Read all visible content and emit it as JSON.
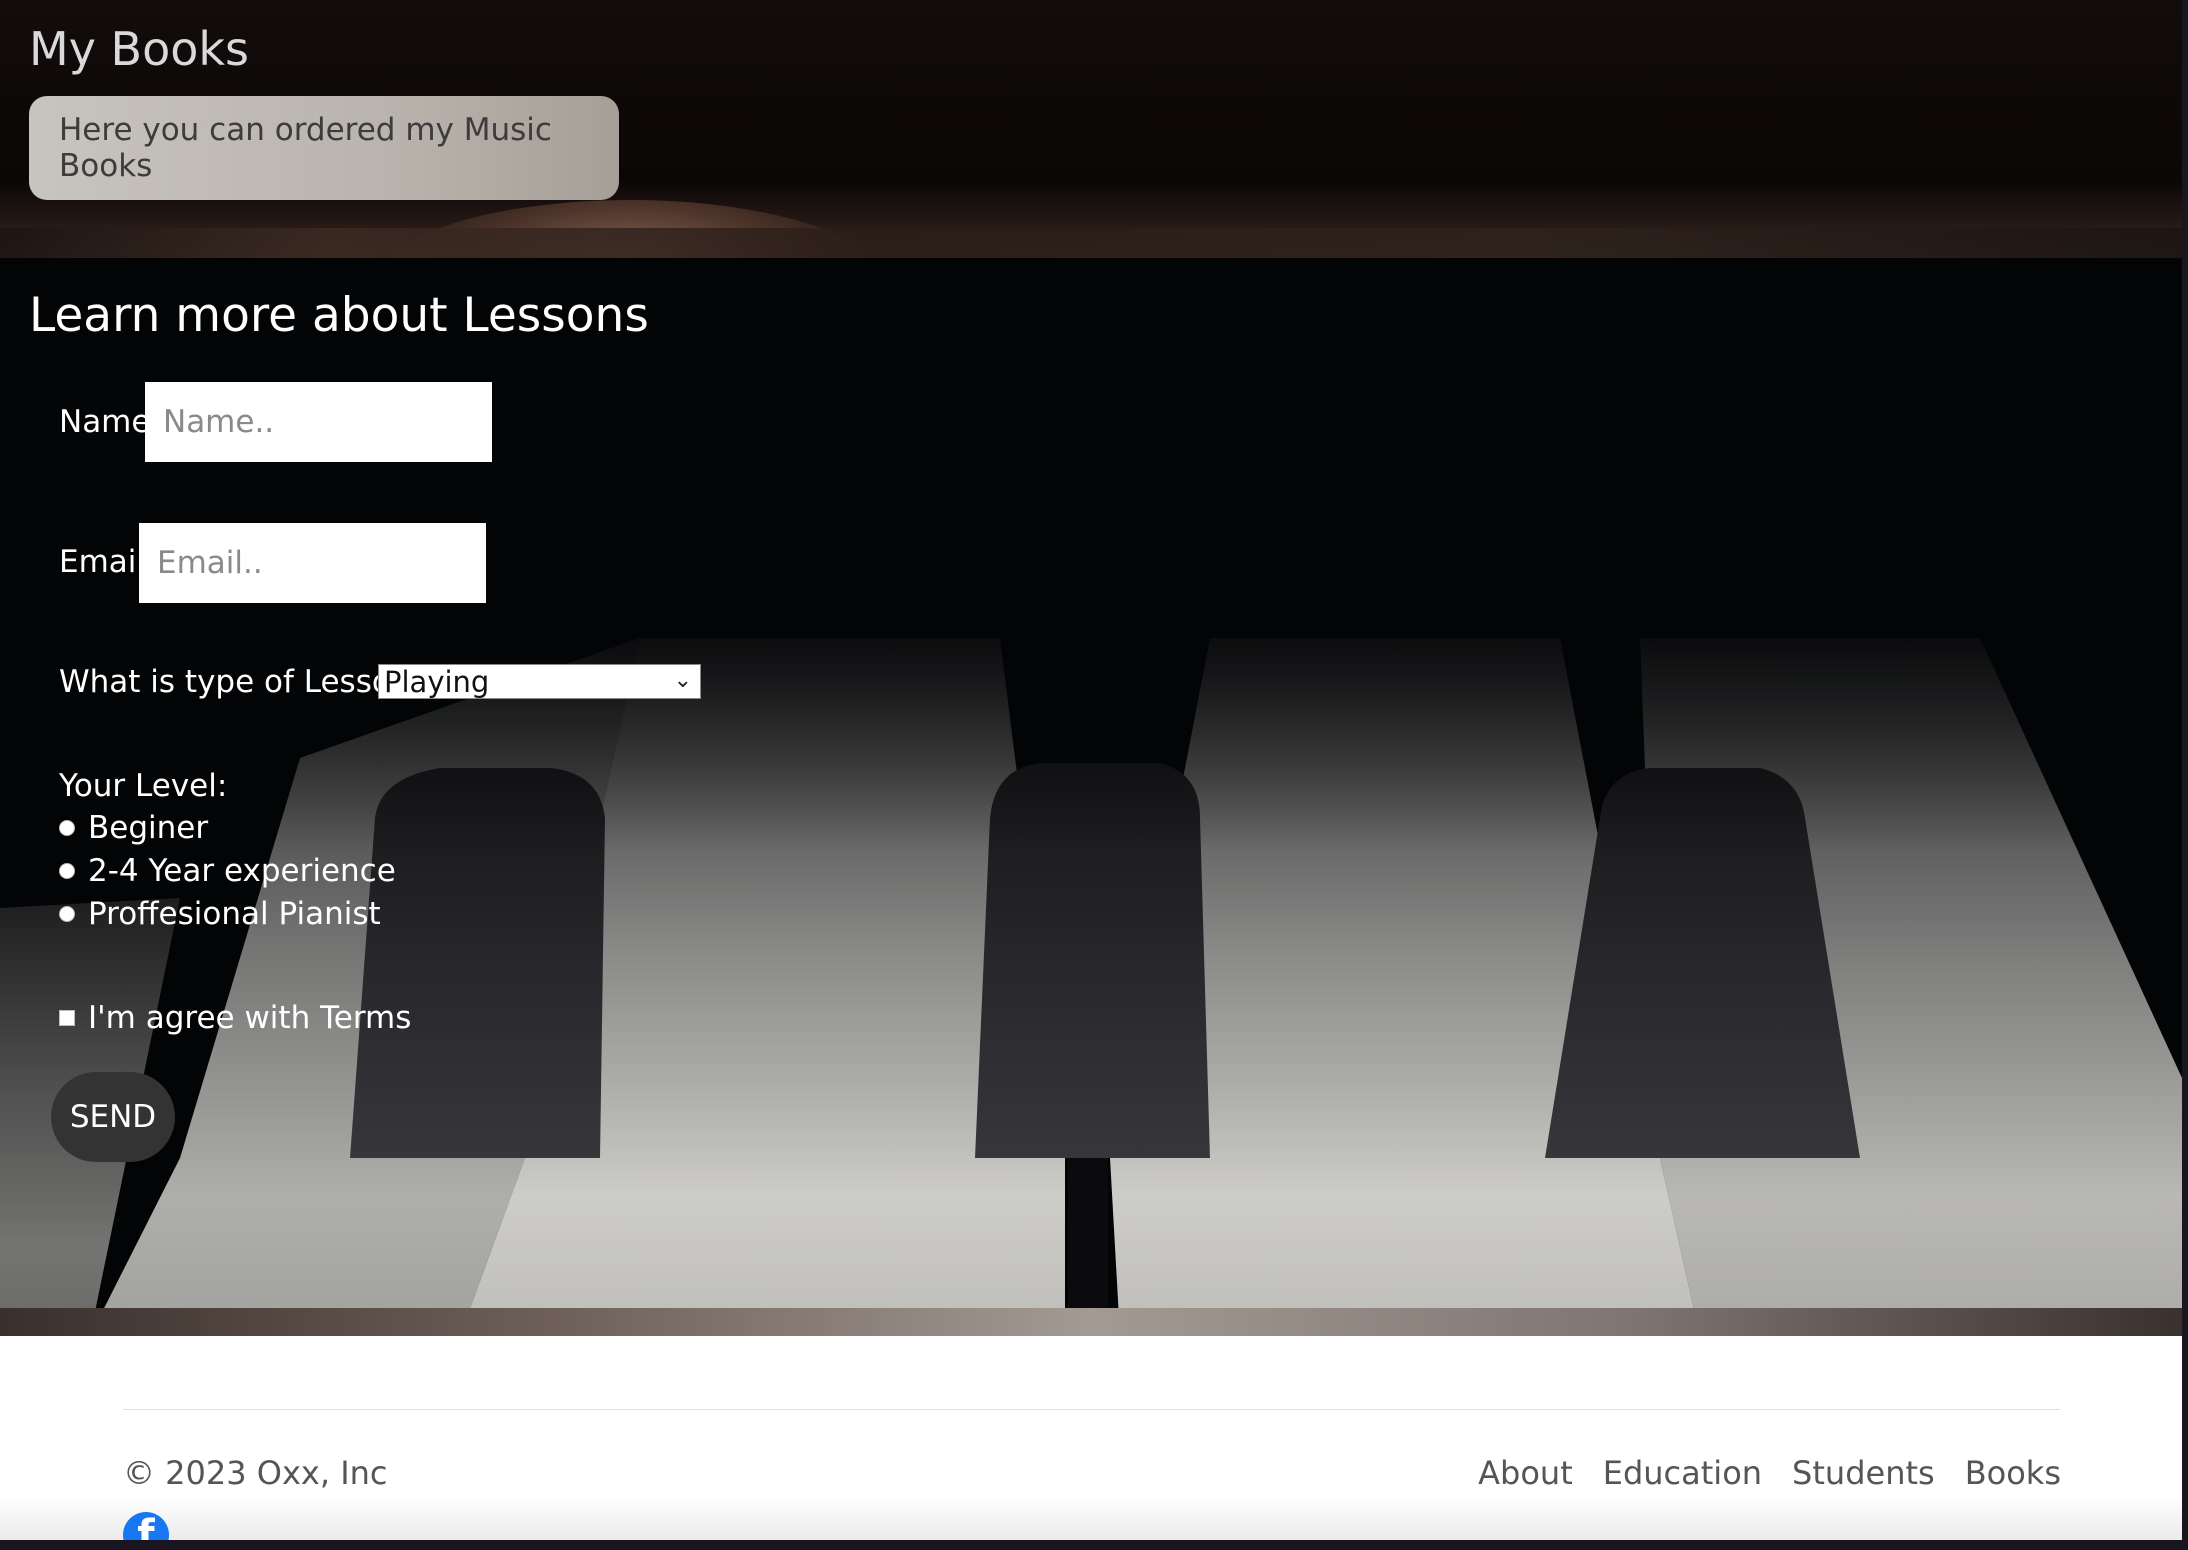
{
  "header": {
    "title": "My Books",
    "card_text": "Here you can ordered my Music Books"
  },
  "form": {
    "title": "Learn more about Lessons",
    "name_label": "Name",
    "name_placeholder": "Name..",
    "email_label": "Email",
    "email_placeholder": "Email..",
    "lesson_type_label": "What is type of Lessons",
    "lesson_type_selected": "Playing",
    "level_label": "Your Level:",
    "levels": [
      "Beginer",
      "2-4 Year experience",
      "Proffesional Pianist"
    ],
    "terms_label": "I'm agree with Terms",
    "send_label": "SEND"
  },
  "footer": {
    "copyright": "© 2023 Oxx, Inc",
    "nav": [
      "About",
      "Education",
      "Students",
      "Books"
    ],
    "social_icon": "facebook-icon"
  },
  "colors": {
    "send_button": "#333333",
    "facebook": "#1877f2"
  }
}
